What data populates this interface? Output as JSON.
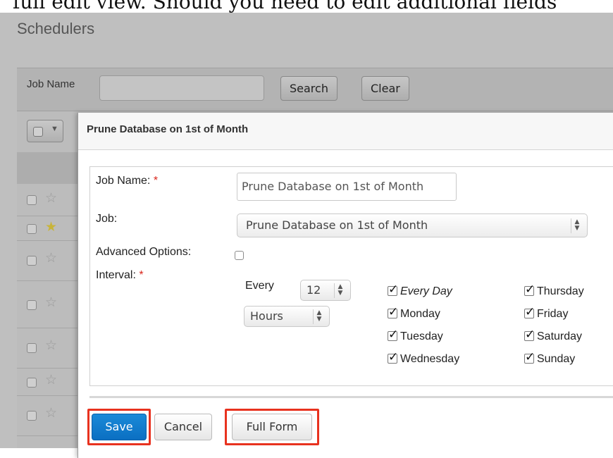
{
  "top_text": "full edit view. Should you need to edit additional fields",
  "page": {
    "title": "Schedulers",
    "filter": {
      "label": "Job Name",
      "value": "",
      "search_label": "Search",
      "clear_label": "Clear"
    },
    "rows": [
      {
        "favorite": false
      },
      {
        "favorite": true
      },
      {
        "favorite": false
      },
      {
        "favorite": false
      },
      {
        "favorite": false
      },
      {
        "favorite": false
      },
      {
        "favorite": false
      }
    ]
  },
  "modal": {
    "title": "Prune Database on 1st of Month",
    "fields": {
      "job_name_label": "Job Name:",
      "job_name_value": "Prune Database on 1st of Month",
      "job_label": "Job:",
      "job_value": "Prune Database on 1st of Month",
      "advanced_label": "Advanced Options:",
      "advanced_checked": false,
      "interval_label": "Interval:",
      "required_marker": "*",
      "every_label": "Every",
      "every_value": "12",
      "unit_value": "Hours"
    },
    "days": {
      "every_day": "Every Day",
      "monday": "Monday",
      "tuesday": "Tuesday",
      "wednesday": "Wednesday",
      "thursday": "Thursday",
      "friday": "Friday",
      "saturday": "Saturday",
      "sunday": "Sunday"
    },
    "buttons": {
      "save": "Save",
      "cancel": "Cancel",
      "full_form": "Full Form"
    }
  },
  "colors": {
    "primary_button": "#0b6fc2",
    "highlight": "#e8321f",
    "required": "#d9261c"
  }
}
